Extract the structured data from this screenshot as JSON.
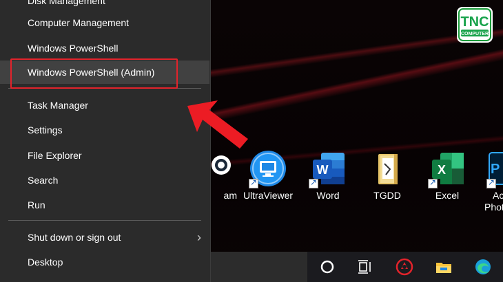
{
  "context_menu": {
    "items": [
      {
        "label": "Disk Management"
      },
      {
        "label": "Computer Management"
      },
      {
        "label": "Windows PowerShell"
      },
      {
        "label": "Windows PowerShell (Admin)"
      },
      {
        "label": "Task Manager"
      },
      {
        "label": "Settings"
      },
      {
        "label": "File Explorer"
      },
      {
        "label": "Search"
      },
      {
        "label": "Run"
      },
      {
        "label": "Shut down or sign out"
      },
      {
        "label": "Desktop"
      }
    ],
    "submenu_arrow": "›"
  },
  "logo": {
    "brand": "TNC",
    "subtitle": "COMPUTER"
  },
  "desktop_icons": [
    {
      "label": "am",
      "icon": "steam-icon"
    },
    {
      "label": "UltraViewer",
      "icon": "ultraviewer-icon"
    },
    {
      "label": "Word",
      "icon": "word-icon"
    },
    {
      "label": "TGDD",
      "icon": "folder-icon"
    },
    {
      "label": "Excel",
      "icon": "excel-icon"
    },
    {
      "label": "Ac",
      "label2": "Photo",
      "icon": "photoshop-icon"
    }
  ],
  "taskbar": {
    "icons": [
      "cortana-icon",
      "task-view-icon",
      "app-icon",
      "file-explorer-icon",
      "edge-icon"
    ]
  },
  "colors": {
    "highlight": "#e3232b",
    "menu_bg": "#2b2b2b",
    "word_blue": "#185abd",
    "excel_green": "#107c41"
  }
}
